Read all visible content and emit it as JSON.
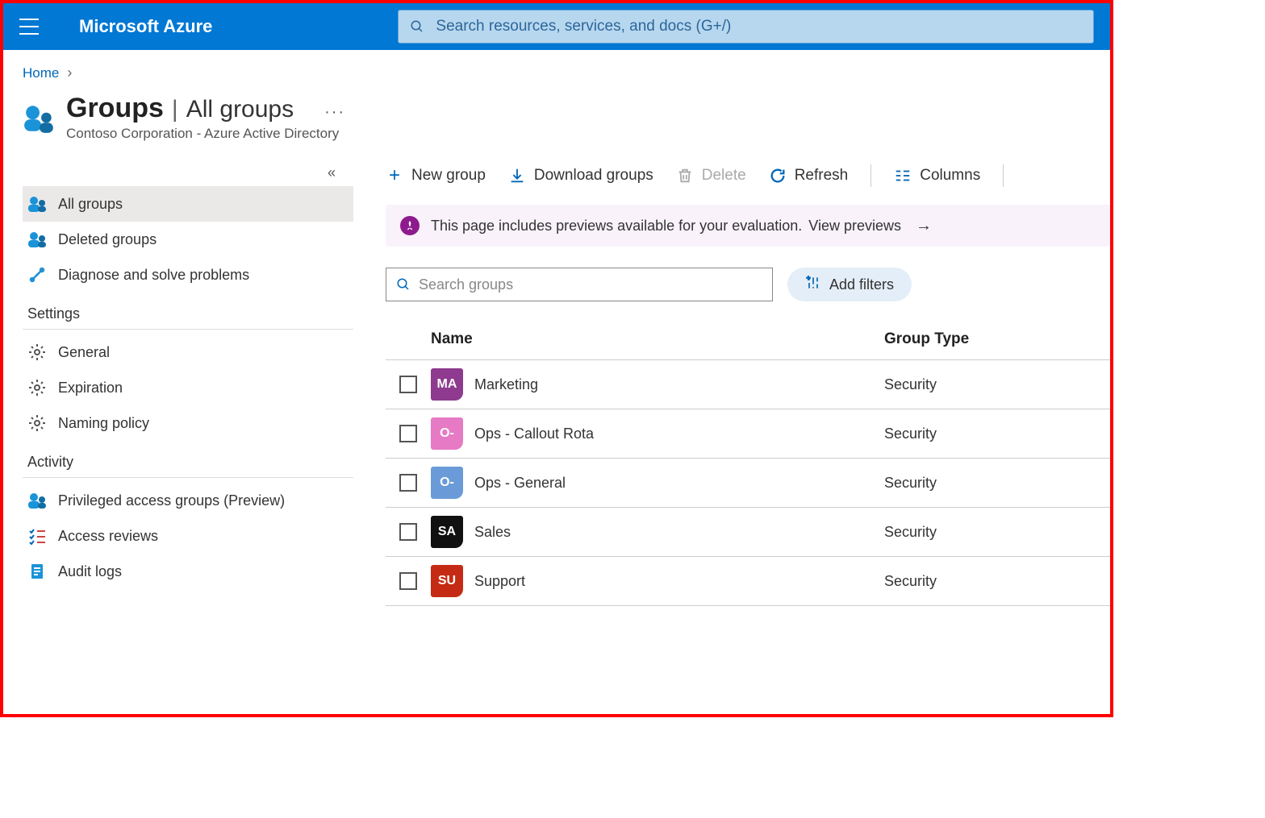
{
  "header": {
    "brand": "Microsoft Azure",
    "search_placeholder": "Search resources, services, and docs (G+/)"
  },
  "breadcrumb": {
    "home": "Home"
  },
  "page": {
    "title_main": "Groups",
    "title_sub": "All groups",
    "subtitle": "Contoso Corporation - Azure Active Directory",
    "more": "···"
  },
  "sidebar": {
    "items": [
      {
        "label": "All groups"
      },
      {
        "label": "Deleted groups"
      },
      {
        "label": "Diagnose and solve problems"
      }
    ],
    "settings_label": "Settings",
    "settings": [
      {
        "label": "General"
      },
      {
        "label": "Expiration"
      },
      {
        "label": "Naming policy"
      }
    ],
    "activity_label": "Activity",
    "activity": [
      {
        "label": "Privileged access groups (Preview)"
      },
      {
        "label": "Access reviews"
      },
      {
        "label": "Audit logs"
      }
    ]
  },
  "toolbar": {
    "new_group": "New group",
    "download": "Download groups",
    "delete": "Delete",
    "refresh": "Refresh",
    "columns": "Columns"
  },
  "banner": {
    "text": "This page includes previews available for your evaluation.",
    "link": "View previews"
  },
  "filters": {
    "search_placeholder": "Search groups",
    "add_filters": "Add filters"
  },
  "table": {
    "headers": {
      "name": "Name",
      "type": "Group Type"
    },
    "rows": [
      {
        "initials": "MA",
        "name": "Marketing",
        "type": "Security",
        "color": "#8e3a8e"
      },
      {
        "initials": "O-",
        "name": "Ops - Callout Rota",
        "type": "Security",
        "color": "#e67ac4"
      },
      {
        "initials": "O-",
        "name": "Ops - General",
        "type": "Security",
        "color": "#6a9bd8"
      },
      {
        "initials": "SA",
        "name": "Sales",
        "type": "Security",
        "color": "#111111"
      },
      {
        "initials": "SU",
        "name": "Support",
        "type": "Security",
        "color": "#c52b14"
      }
    ]
  }
}
